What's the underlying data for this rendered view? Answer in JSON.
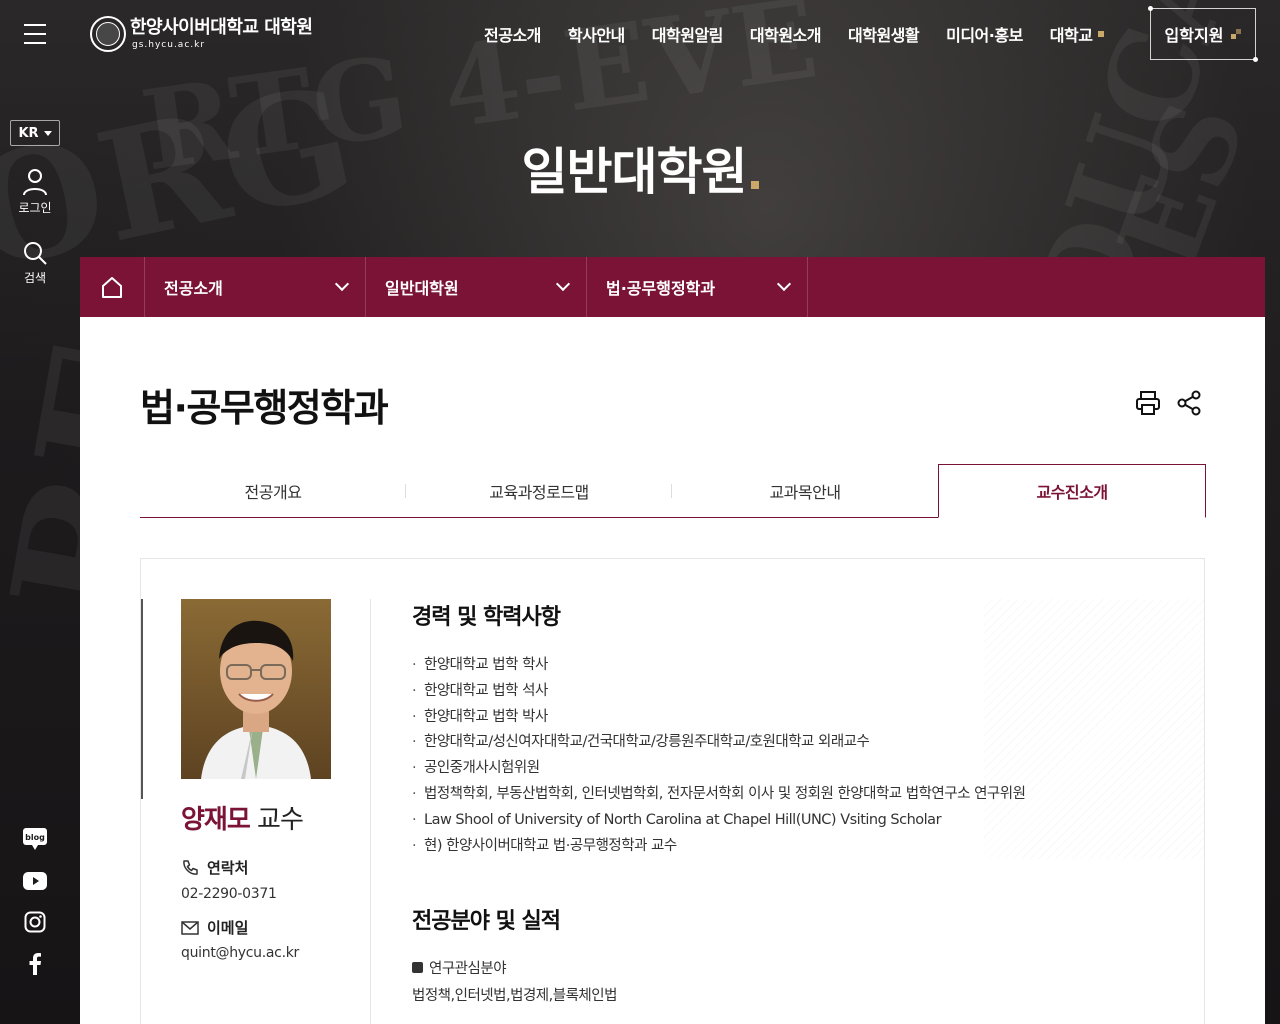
{
  "header": {
    "logo_title": "한양사이버대학교 대학원",
    "logo_domain": "gs.hycu.ac.kr",
    "nav": [
      {
        "label": "전공소개"
      },
      {
        "label": "학사안내"
      },
      {
        "label": "대학원알림"
      },
      {
        "label": "대학원소개"
      },
      {
        "label": "대학원생활"
      },
      {
        "label": "미디어·홍보"
      },
      {
        "label": "대학교"
      }
    ],
    "apply_label": "입학지원"
  },
  "rail": {
    "lang": "KR",
    "login_label": "로그인",
    "search_label": "검색",
    "social_icons": [
      "blog-icon",
      "youtube-icon",
      "instagram-icon",
      "facebook-icon"
    ]
  },
  "hero": {
    "title": "일반대학원"
  },
  "breadcrumb": {
    "items": [
      {
        "label": "전공소개"
      },
      {
        "label": "일반대학원"
      },
      {
        "label": "법·공무행정학과"
      }
    ]
  },
  "page": {
    "title": "법·공무행정학과",
    "tabs": [
      {
        "label": "전공개요",
        "active": false
      },
      {
        "label": "교육과정로드맵",
        "active": false
      },
      {
        "label": "교과목안내",
        "active": false
      },
      {
        "label": "교수진소개",
        "active": true
      }
    ]
  },
  "professor": {
    "name": "양재모",
    "rank": "교수",
    "contact_label": "연락처",
    "phone": "02-2290-0371",
    "email_label": "이메일",
    "email": "quint@hycu.ac.kr",
    "career_title": "경력 및 학력사항",
    "career": [
      "한양대학교 법학 학사",
      "한양대학교 법학 석사",
      "한양대학교 법학 박사",
      "한양대학교/성신여자대학교/건국대학교/강릉원주대학교/호원대학교 외래교수",
      "공인중개사시험위원",
      "법정책학회, 부동산법학회, 인터넷법학회, 전자문서학회 이사 및 정회원 한양대학교 법학연구소 연구위원",
      "Law Shool of University of North Carolina at Chapel Hill(UNC) Vsiting Scholar",
      "현) 한양사이버대학교 법·공무행정학과 교수"
    ],
    "field_title": "전공분야 및 실적",
    "interest_label": "연구관심분야",
    "interest_value": "법정책,인터넷법,법경제,블록체인법"
  },
  "colors": {
    "brand": "#7a1335",
    "gold": "#c9a86a"
  }
}
